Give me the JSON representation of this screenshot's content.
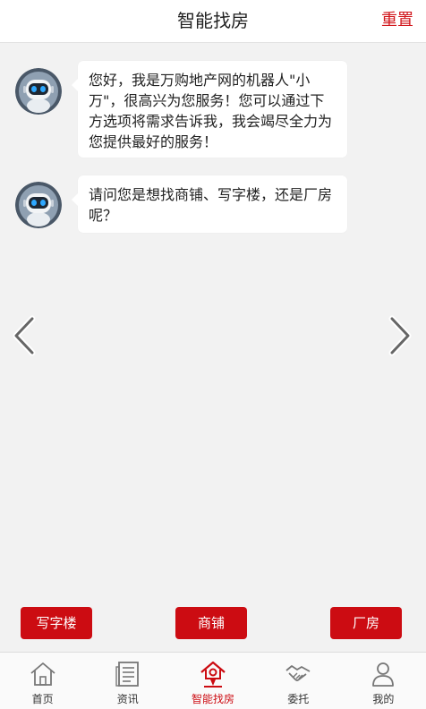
{
  "header": {
    "title": "智能找房",
    "reset_label": "重置"
  },
  "messages": [
    {
      "text": "您好，我是万购地产网的机器人\"小万\"，很高兴为您服务！您可以通过下方选项将需求告诉我，我会竭尽全力为您提供最好的服务！"
    },
    {
      "text": "请问您是想找商铺、写字楼，还是厂房呢？"
    }
  ],
  "options": [
    "写字楼",
    "商铺",
    "厂房"
  ],
  "tabs": [
    {
      "label": "首页",
      "icon": "home-icon"
    },
    {
      "label": "资讯",
      "icon": "news-icon"
    },
    {
      "label": "智能找房",
      "icon": "smart-house-icon",
      "active": true
    },
    {
      "label": "委托",
      "icon": "handshake-icon"
    },
    {
      "label": "我的",
      "icon": "user-icon"
    }
  ],
  "colors": {
    "accent": "#cc0c12",
    "reset": "#d1161b",
    "background": "#f2f2f2"
  }
}
